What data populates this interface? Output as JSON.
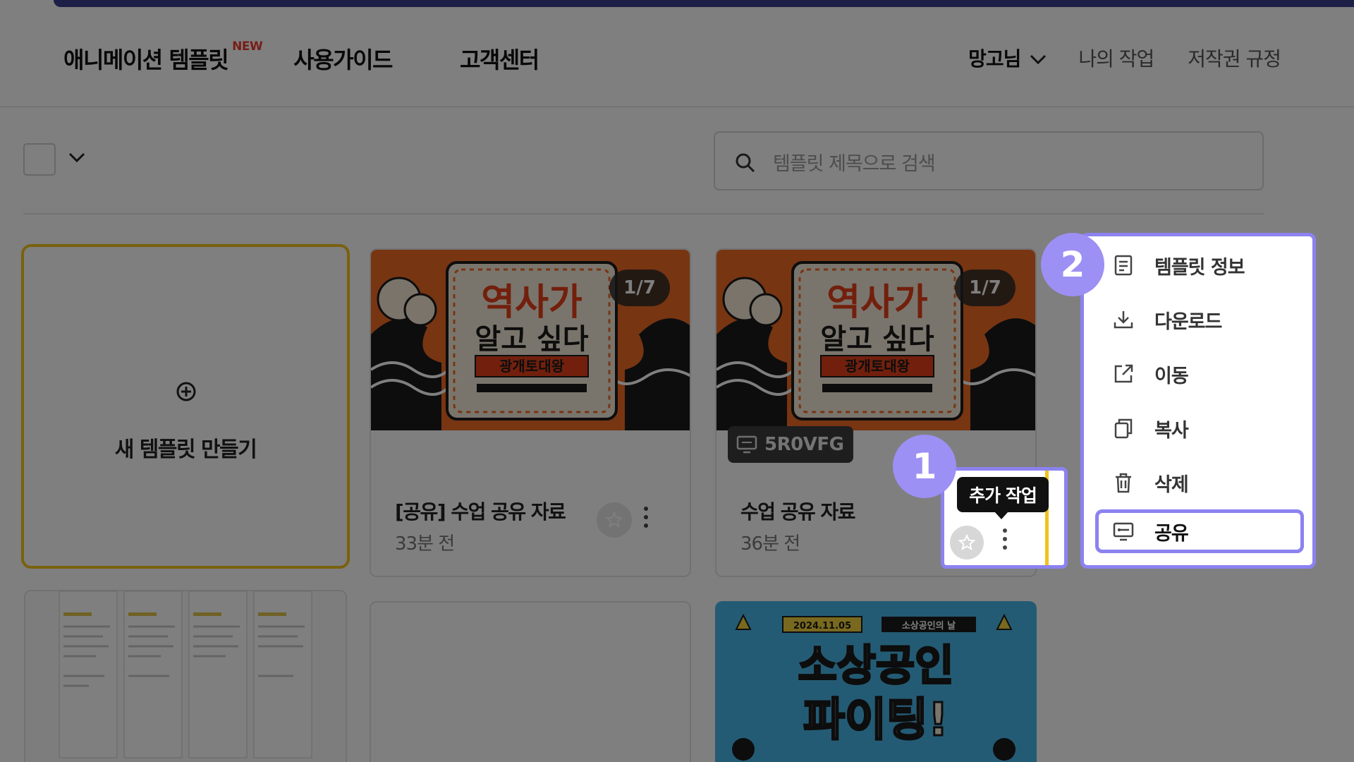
{
  "header": {
    "nav": {
      "templates": "애니메이션 템플릿",
      "new_badge": "NEW",
      "guide": "사용가이드",
      "support": "고객센터"
    },
    "user_name": "망고님",
    "my_work": "나의 작업",
    "copyright": "저작권 규정"
  },
  "toolbar": {
    "search_placeholder": "템플릿 제목으로 검색"
  },
  "cards": {
    "new_template_label": "새 템플릿 만들기",
    "items": [
      {
        "title": "[공유] 수업 공유 자료",
        "time": "33분 전",
        "page_badge": "1/7",
        "thumb_title_line1": "역사가",
        "thumb_title_line2": "알고 싶다",
        "thumb_subtitle": "광개토대왕"
      },
      {
        "title": "수업 공유 자료",
        "time": "36분 전",
        "page_badge": "1/7",
        "share_code": "5R0VFG",
        "thumb_title_line1": "역사가",
        "thumb_title_line2": "알고 싶다",
        "thumb_subtitle": "광개토대왕"
      },
      {
        "thumb_date": "2024.11.05",
        "thumb_tag": "소상공인의 날",
        "thumb_line1": "소상공인",
        "thumb_line2": "파이팅!"
      }
    ]
  },
  "tooltip": "추가 작업",
  "context_menu": {
    "items": [
      {
        "label": "템플릿 정보",
        "icon": "document-icon"
      },
      {
        "label": "다운로드",
        "icon": "download-icon"
      },
      {
        "label": "이동",
        "icon": "external-link-icon"
      },
      {
        "label": "복사",
        "icon": "copy-icon"
      },
      {
        "label": "삭제",
        "icon": "trash-icon"
      },
      {
        "label": "공유",
        "icon": "share-screen-icon"
      }
    ]
  },
  "steps": {
    "first": "1",
    "second": "2"
  },
  "colors": {
    "accent_bar": "#3d3f8f",
    "highlight": "#8c82f0",
    "step_marker": "#9c90f4",
    "new_card_border": "#f2c21b",
    "thumb_orange": "#f06a24",
    "new_badge": "#ee3b2f"
  }
}
